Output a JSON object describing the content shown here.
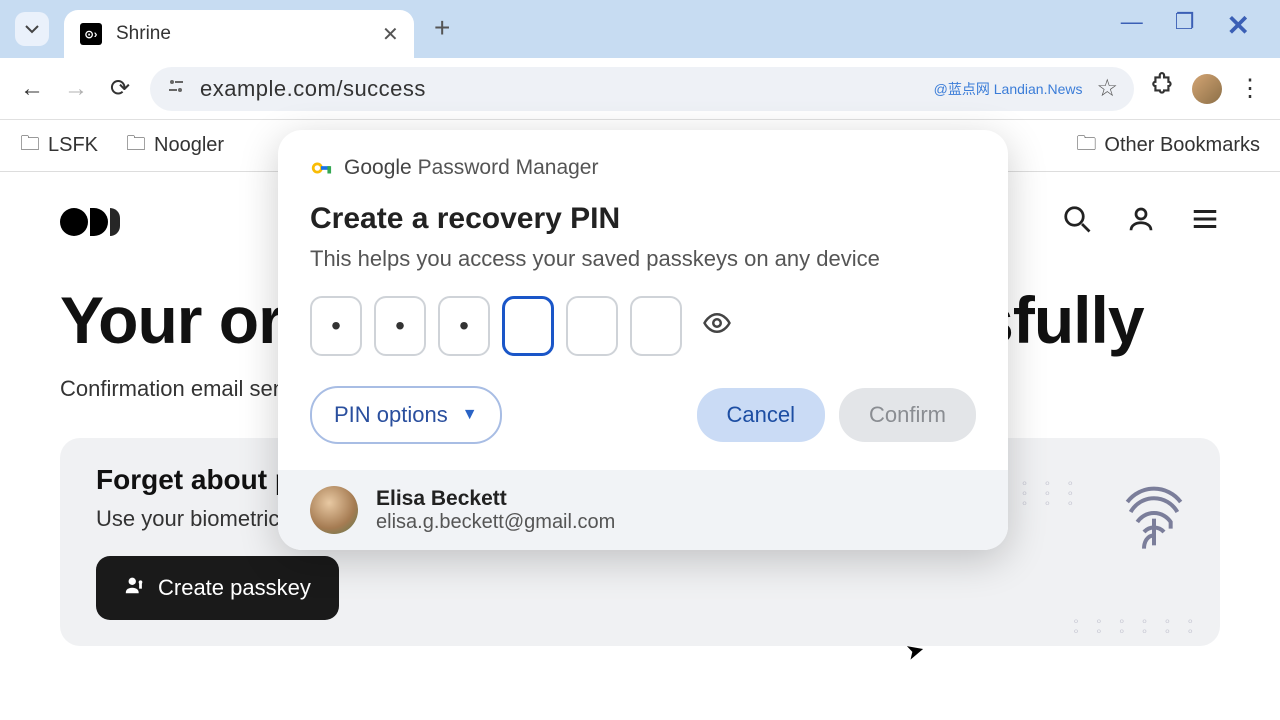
{
  "browser": {
    "tab": {
      "title": "Shrine"
    },
    "url": "example.com/success",
    "watermark": "@蓝点网 Landian.News",
    "bookmarks": [
      "LSFK",
      "Noogler"
    ],
    "other_bookmarks": "Other Bookmarks"
  },
  "page": {
    "headline": "Your order was placed successfully",
    "subtext": "Confirmation email sent to",
    "passkey_heading": "Forget about passwords",
    "passkey_desc": "Use your biometric",
    "create_passkey_label": "Create passkey"
  },
  "modal": {
    "brand_strong": "Google",
    "brand_rest": "Password Manager",
    "title": "Create a recovery PIN",
    "desc": "This helps you access your saved passkeys on any device",
    "pin": [
      "•",
      "•",
      "•",
      "",
      "",
      ""
    ],
    "active_index": 3,
    "pin_options_label": "PIN options",
    "cancel_label": "Cancel",
    "confirm_label": "Confirm"
  },
  "account": {
    "name": "Elisa Beckett",
    "email": "elisa.g.beckett@gmail.com"
  }
}
